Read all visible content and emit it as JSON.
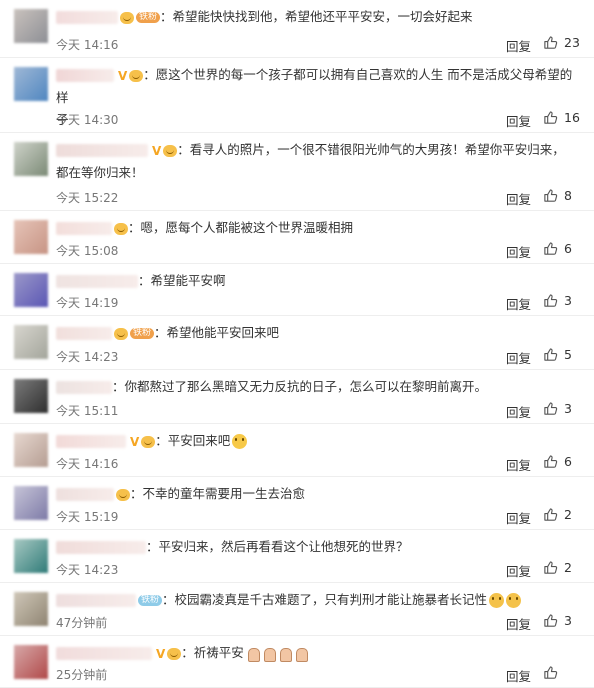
{
  "ui": {
    "reply_label": "回复"
  },
  "comments": [
    {
      "text": "：希望能快快找到他，希望他还平平安安，一切会好起来",
      "time": "今天 14:16",
      "likes": "23",
      "badge_v": false,
      "badge_fan": "铁粉",
      "emoji_badge": true
    },
    {
      "text": "：愿这个世界的每一个孩子都可以拥有自己喜欢的人生 而不是活成父母希望的样",
      "text2": "子",
      "time": "今天 14:30",
      "likes": "16",
      "badge_v": true,
      "emoji_badge": true
    },
    {
      "text": "：看寻人的照片，一个很不错很阳光帅气的大男孩！希望你平安归来，",
      "text2": "都在等你归来！",
      "time": "今天 15:22",
      "likes": "8",
      "badge_v": true,
      "emoji_badge": true
    },
    {
      "text": "：嗯，愿每个人都能被这个世界温暖相拥",
      "time": "今天 15:08",
      "likes": "6",
      "emoji_badge": true
    },
    {
      "text": "：希望能平安啊",
      "time": "今天 14:19",
      "likes": "3"
    },
    {
      "text": "：希望他能平安回来吧",
      "time": "今天 14:23",
      "likes": "5",
      "badge_fan": "铁粉",
      "emoji_badge": true
    },
    {
      "text": "：你都熬过了那么黑暗又无力反抗的日子，怎么可以在黎明前离开。",
      "time": "今天 15:11",
      "likes": "3"
    },
    {
      "text": "：平安回来吧",
      "time": "今天 14:16",
      "likes": "6",
      "badge_v": true,
      "emoji_badge": true,
      "trailing_emoji": "worried-face-emoji"
    },
    {
      "text": "：不幸的童年需要用一生去治愈",
      "time": "今天 15:19",
      "likes": "2",
      "emoji_badge": true
    },
    {
      "text": "：平安归来，然后再看看这个让他想死的世界？",
      "time": "今天 14:23",
      "likes": "2"
    },
    {
      "text": "：校园霸凌真是千古难题了，只有判刑才能让施暴者长记性",
      "time": "47分钟前",
      "likes": "3",
      "badge_fan": "铁粉",
      "badge_fan_color": "blue",
      "trailing_emoji": "crying-face-emoji"
    },
    {
      "text": "：祈祷平安",
      "time": "25分钟前",
      "likes": "",
      "badge_v": true,
      "emoji_badge": true,
      "trailing_emoji": "praying-hands-emoji"
    }
  ]
}
